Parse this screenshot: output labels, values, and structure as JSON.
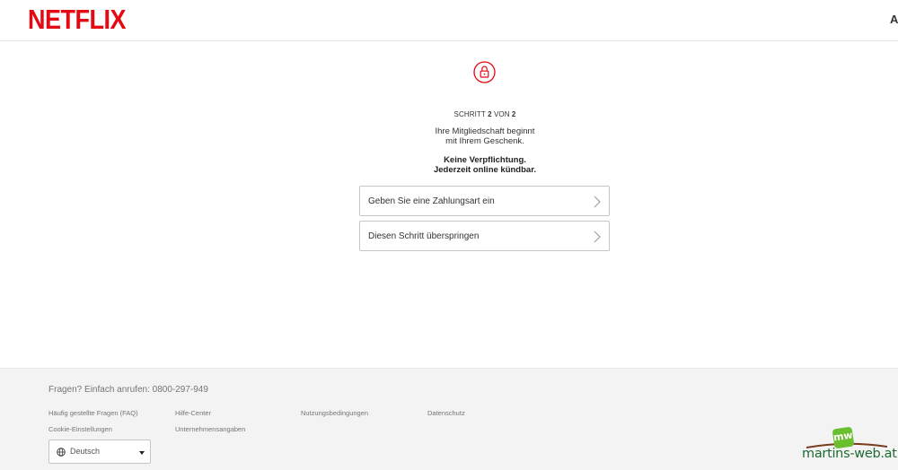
{
  "header": {
    "logo": "NETFLIX",
    "right_text": "A"
  },
  "main": {
    "step_prefix": "SCHRITT ",
    "step_current": "2",
    "step_mid": " VON ",
    "step_total": "2",
    "lead_line1": "Ihre Mitgliedschaft beginnt",
    "lead_line2": "mit Ihrem Geschenk.",
    "note_line1": "Keine Verpflichtung.",
    "note_line2": "Jederzeit online kündbar.",
    "options": [
      {
        "label": "Geben Sie eine Zahlungsart ein"
      },
      {
        "label": "Diesen Schritt überspringen"
      }
    ]
  },
  "footer": {
    "questions": "Fragen? Einfach anrufen: 0800-297-949",
    "links": [
      "Häufig gestellte Fragen (FAQ)",
      "Hilfe-Center",
      "Nutzungsbedingungen",
      "Datenschutz",
      "Cookie-Einstellungen",
      "Unternehmensangaben"
    ],
    "language": "Deutsch"
  },
  "watermark": {
    "text": "martins-web.at",
    "badge": "mw"
  },
  "colors": {
    "brand": "#e50914",
    "footer_bg": "#f3f3f3",
    "watermark_green": "#1f6a33"
  }
}
